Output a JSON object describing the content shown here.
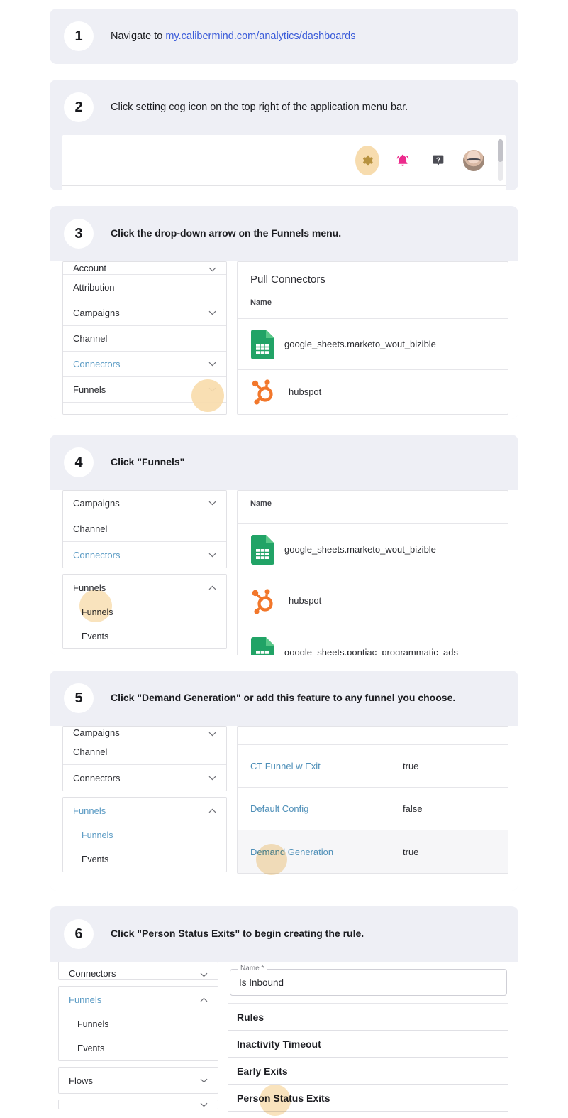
{
  "steps": [
    {
      "number": "1",
      "text_before": "Navigate to ",
      "link": "my.calibermind.com/analytics/dashboards"
    },
    {
      "number": "2",
      "text": "Click setting cog icon on the top right of the application menu bar.",
      "toolbar": {
        "icons": [
          "gear-icon",
          "bell-icon",
          "help-icon",
          "avatar"
        ]
      }
    },
    {
      "number": "3",
      "text": "Click the drop-down arrow on the Funnels menu.",
      "sidebar": [
        {
          "label": "Account",
          "chevron": "down",
          "active": false,
          "clipped": true
        },
        {
          "label": "Attribution",
          "chevron": "none",
          "active": false
        },
        {
          "label": "Campaigns",
          "chevron": "down",
          "active": false
        },
        {
          "label": "Channel",
          "chevron": "none",
          "active": false
        },
        {
          "label": "Connectors",
          "chevron": "down",
          "active": true
        },
        {
          "label": "Funnels",
          "chevron": "down",
          "active": false
        }
      ],
      "content": {
        "title": "Pull Connectors",
        "column": "Name",
        "rows": [
          {
            "icon": "google-sheets-icon",
            "name": "google_sheets.marketo_wout_bizible"
          },
          {
            "icon": "hubspot-icon",
            "name": "hubspot"
          }
        ]
      }
    },
    {
      "number": "4",
      "text": "Click \"Funnels\"",
      "sidebar": [
        {
          "label": "Campaigns",
          "chevron": "down",
          "active": false
        },
        {
          "label": "Channel",
          "chevron": "none",
          "active": false
        },
        {
          "label": "Connectors",
          "chevron": "down",
          "active": true
        }
      ],
      "sidebar_group": {
        "label": "Funnels",
        "chevron": "up",
        "active": false,
        "children": [
          {
            "label": "Funnels",
            "active": false
          },
          {
            "label": "Events",
            "active": false
          }
        ]
      },
      "content": {
        "column": "Name",
        "rows": [
          {
            "icon": "google-sheets-icon",
            "name": "google_sheets.marketo_wout_bizible"
          },
          {
            "icon": "hubspot-icon",
            "name": "hubspot"
          },
          {
            "icon": "google-sheets-icon",
            "name": "google_sheets.pontiac_programmatic_ads"
          }
        ]
      }
    },
    {
      "number": "5",
      "text": "Click \"Demand Generation\" or add this feature to any funnel you choose.",
      "sidebar": [
        {
          "label": "Campaigns",
          "chevron": "down",
          "active": false,
          "clipped": true
        },
        {
          "label": "Channel",
          "chevron": "none",
          "active": false
        },
        {
          "label": "Connectors",
          "chevron": "down",
          "active": false
        }
      ],
      "sidebar_group": {
        "label": "Funnels",
        "chevron": "up",
        "active": true,
        "children": [
          {
            "label": "Funnels",
            "active": true
          },
          {
            "label": "Events",
            "active": false
          }
        ]
      },
      "table": {
        "rows": [
          {
            "name": "CT Funnel w Exit",
            "value": "true",
            "hovered": false
          },
          {
            "name": "Default Config",
            "value": "false",
            "hovered": false
          },
          {
            "name": "Demand Generation",
            "value": "true",
            "hovered": true
          }
        ]
      }
    },
    {
      "number": "6",
      "text": "Click \"Person Status Exits\" to begin creating the rule.",
      "sidebar": [
        {
          "label": "Connectors",
          "chevron": "down",
          "active": false,
          "clipped": true
        }
      ],
      "sidebar_group": {
        "label": "Funnels",
        "chevron": "up",
        "active": true,
        "children": [
          {
            "label": "Funnels",
            "active": false
          },
          {
            "label": "Events",
            "active": false
          }
        ]
      },
      "sidebar_after": [
        {
          "label": "Flows",
          "chevron": "down",
          "active": false
        },
        {
          "label": "",
          "chevron": "down",
          "active": false,
          "clipped": true
        }
      ],
      "form": {
        "name_label": "Name *",
        "name_value": "Is Inbound",
        "sections": [
          "Rules",
          "Inactivity Timeout",
          "Early Exits",
          "Person Status Exits"
        ]
      }
    }
  ],
  "colors": {
    "card_bg": "#eeeff5",
    "highlight": "#f8dcad",
    "link": "#3a5bd9",
    "active_nav": "#5b9bc4",
    "table_link": "#4e8fb8"
  }
}
